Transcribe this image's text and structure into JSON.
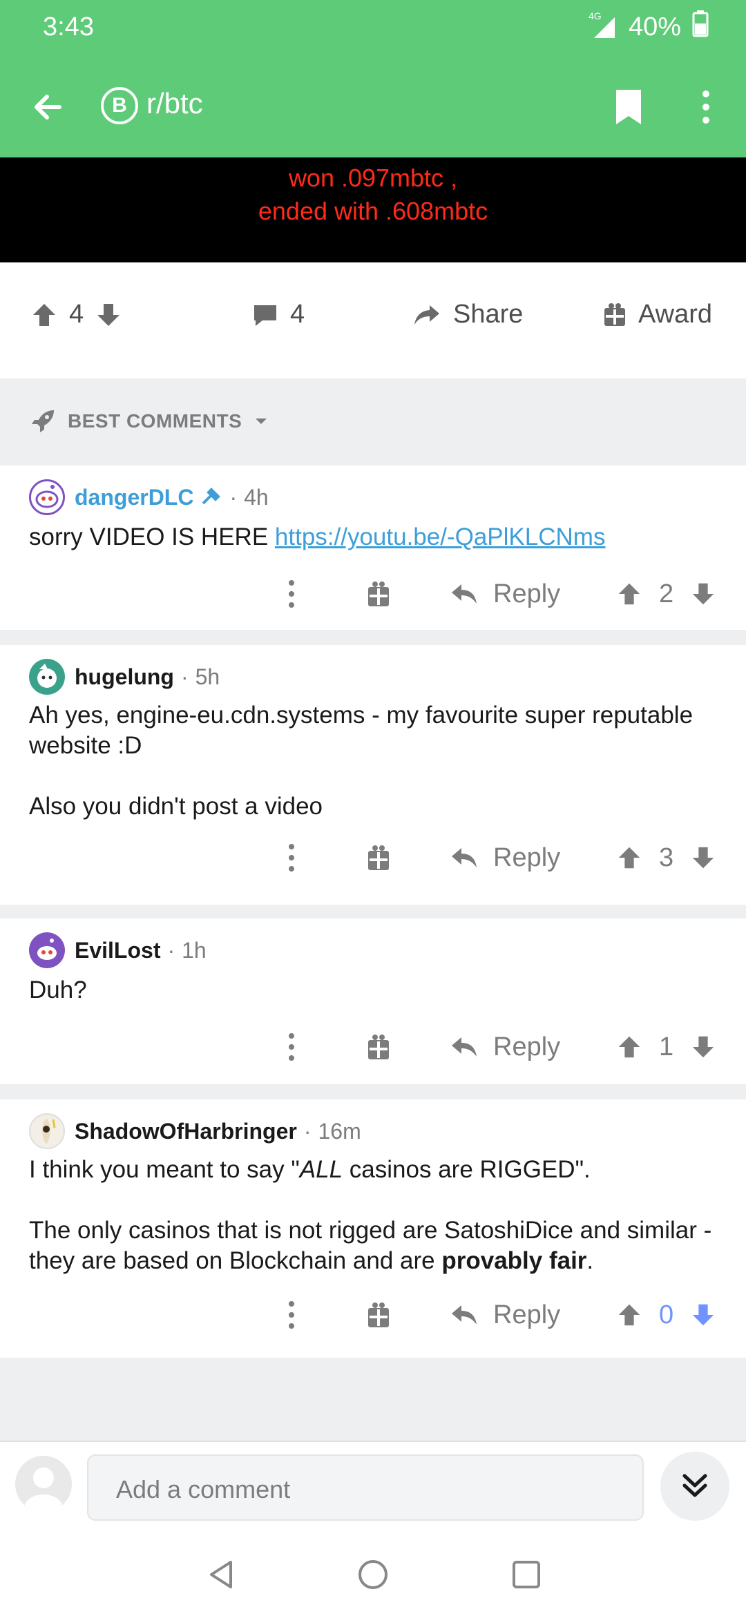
{
  "status_bar": {
    "time": "3:43",
    "network": "4G",
    "battery": "40%"
  },
  "toolbar": {
    "subreddit": "r/btc",
    "subreddit_icon_letter": "B"
  },
  "post": {
    "image_text_line1": "won .097mbtc ,",
    "image_text_line2": "ended with .608mbtc",
    "score": "4",
    "comment_count": "4",
    "share_label": "Share",
    "award_label": "Award"
  },
  "sort": {
    "label": "BEST COMMENTS"
  },
  "comments": [
    {
      "author": "dangerDLC",
      "time": "4h",
      "body_text": "sorry VIDEO IS HERE ",
      "body_link": "https://youtu.be/-QaPlKLCNms",
      "reply_label": "Reply",
      "score": "2"
    },
    {
      "author": "hugelung",
      "time": "5h",
      "body_p1": "Ah yes, engine-eu.cdn.systems - my favourite super reputable website :D",
      "body_p2": "Also you didn't post a video",
      "reply_label": "Reply",
      "score": "3"
    },
    {
      "author": "EvilLost",
      "time": "1h",
      "body_p1": "Duh?",
      "reply_label": "Reply",
      "score": "1"
    },
    {
      "author": "ShadowOfHarbringer",
      "time": "16m",
      "body_p1_pre": "I think you meant to say \"",
      "body_p1_em": "ALL",
      "body_p1_post": " casinos are RIGGED\".",
      "body_p2_pre": "The only casinos that is not rigged are SatoshiDice and similar - they are based on Blockchain and are ",
      "body_p2_bold": "provably fair",
      "body_p2_post": ".",
      "reply_label": "Reply",
      "score": "0"
    }
  ],
  "composer": {
    "placeholder": "Add a comment"
  },
  "colors": {
    "header": "#5ecb78",
    "accent_blue": "#3d9ed8",
    "downvote_blue": "#7193ff",
    "image_text": "#ff2a1a"
  }
}
